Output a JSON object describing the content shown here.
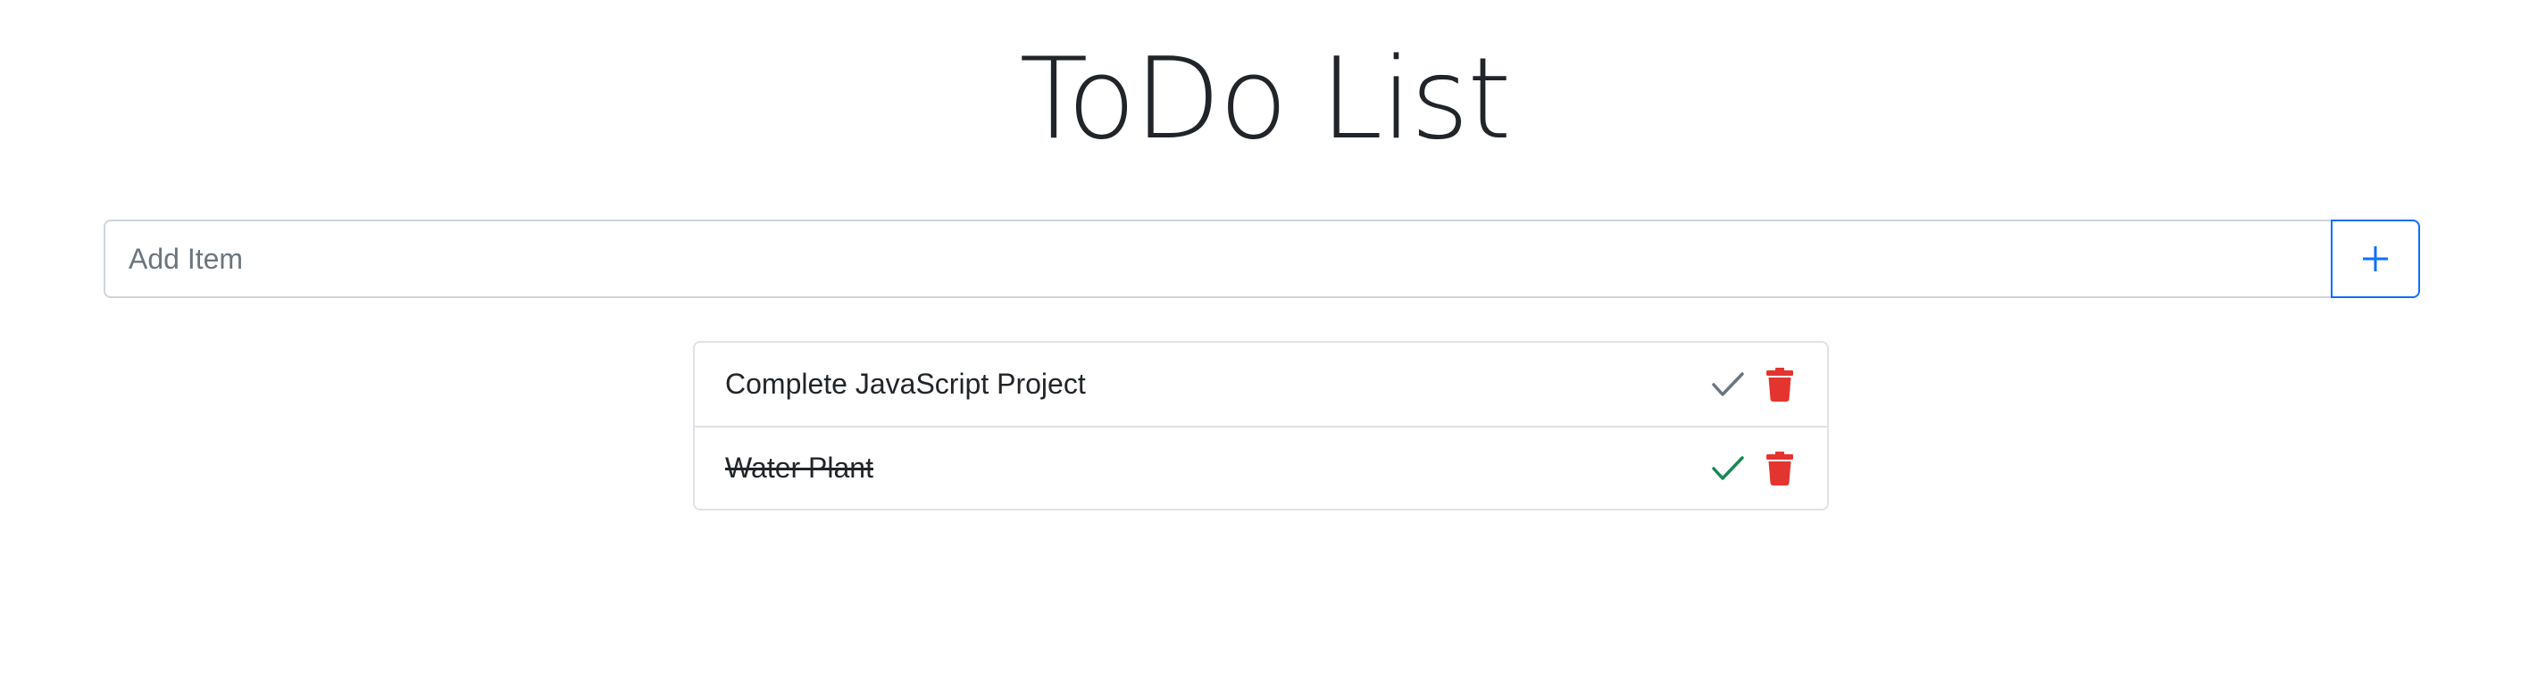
{
  "header": {
    "title": "ToDo List"
  },
  "add_form": {
    "placeholder": "Add Item",
    "button_icon": "plus-icon"
  },
  "colors": {
    "primary": "#0d6efd",
    "danger": "#e3342f",
    "success": "#198754",
    "muted_check": "#6c757d",
    "text": "#212529",
    "border": "#dee2e6"
  },
  "todos": [
    {
      "text": "Complete JavaScript Project",
      "completed": false,
      "check_icon": "check-icon",
      "delete_icon": "trash-icon"
    },
    {
      "text": "Water Plant",
      "completed": true,
      "check_icon": "check-icon",
      "delete_icon": "trash-icon"
    }
  ]
}
